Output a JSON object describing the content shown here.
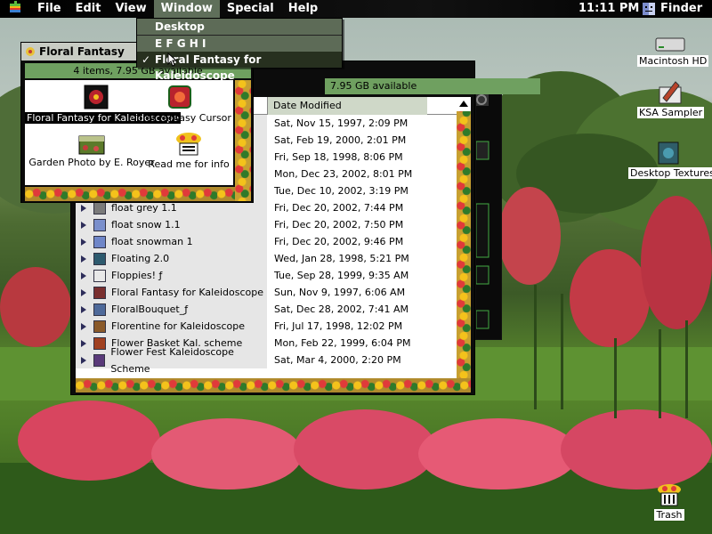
{
  "menubar": {
    "apple_icon": "apple-icon",
    "items": [
      "File",
      "Edit",
      "View",
      "Window",
      "Special",
      "Help"
    ],
    "active": "Window",
    "clock": "11:11 PM",
    "app_name": "Finder",
    "app_icon": "finder-icon"
  },
  "window_menu": {
    "items": [
      {
        "label": "Desktop",
        "checked": false
      },
      {
        "label": "E F G H I",
        "checked": false
      },
      {
        "label": "Floral Fantasy for Kaleidoscope",
        "checked": true
      }
    ],
    "check_mark": "✓"
  },
  "desktop_icons": {
    "hd": "Macintosh HD",
    "ksa": "KSA Sampler",
    "textures": "Desktop Textures",
    "trash": "Trash"
  },
  "front_window": {
    "title": "Floral Fantasy",
    "status": "4 items, 7.95 GB available",
    "items": [
      "Floral Fantasy for Kaleidoscope",
      "Floral Fantasy Cursor",
      "Garden Photo by E. Royer",
      "Read me for info"
    ]
  },
  "back_window": {
    "status": "7.95 GB available",
    "column_header": "Date Modified",
    "rows": [
      {
        "name": "",
        "date": "Sat, Nov 15, 1997, 2:09 PM"
      },
      {
        "name": "",
        "date": "Sat, Feb 19, 2000, 2:01 PM"
      },
      {
        "name": "",
        "date": "Fri, Sep 18, 1998, 8:06 PM"
      },
      {
        "name": "",
        "date": "Mon, Dec 23, 2002, 8:01 PM"
      },
      {
        "name": "",
        "date": "Tue, Dec 10, 2002, 3:19 PM"
      },
      {
        "name": "float grey 1.1",
        "date": "Fri, Dec 20, 2002, 7:44 PM"
      },
      {
        "name": "float snow 1.1",
        "date": "Fri, Dec 20, 2002, 7:50 PM"
      },
      {
        "name": "float snowman 1",
        "date": "Fri, Dec 20, 2002, 9:46 PM"
      },
      {
        "name": "Floating 2.0",
        "date": "Wed, Jan 28, 1998, 5:21 PM"
      },
      {
        "name": "Floppies! ƒ",
        "date": "Tue, Sep 28, 1999, 9:35 AM"
      },
      {
        "name": "Floral Fantasy for Kaleidoscope",
        "date": "Sun, Nov 9, 1997, 6:06 AM"
      },
      {
        "name": "FloralBouquet_ƒ",
        "date": "Sat, Dec 28, 2002, 7:41 AM"
      },
      {
        "name": "Florentine for Kaleidoscope",
        "date": "Fri, Jul 17, 1998, 12:02 PM"
      },
      {
        "name": "Flower Basket Kal. scheme",
        "date": "Mon, Feb 22, 1999, 6:04 PM"
      },
      {
        "name": "Flower Fest Kaleidoscope Scheme",
        "date": "Sat, Mar 4, 2000, 2:20 PM"
      }
    ]
  }
}
